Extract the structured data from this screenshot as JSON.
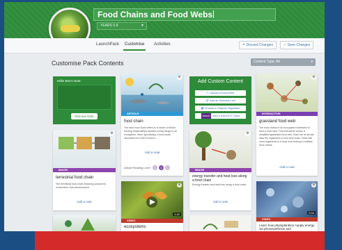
{
  "pack": {
    "title": "Food Chains and Food Webs",
    "level_select": "YEARS 5-8"
  },
  "tabs": [
    {
      "label": "LaunchPack"
    },
    {
      "label": "Customise"
    },
    {
      "label": "Activities"
    }
  ],
  "header_buttons": {
    "discard": "Discard Changes",
    "save": "Save Changes"
  },
  "content": {
    "section_title": "Customise Pack Contents",
    "filter": "Content Type: All"
  },
  "note_card": {
    "label": "Millie Ben's Note:",
    "remove": "Remove Note"
  },
  "custom_card": {
    "title": "Add Custom Content",
    "upload": "Upload a Document",
    "link": "Add an External Link",
    "organiser": "Choose a Graphic Organiser",
    "kahoot_tag": "kahoot",
    "kahoot": "Add a KAHOOT! Quiz"
  },
  "cards": {
    "food_chain": {
      "tag": "ARTICLE",
      "title": "food chain",
      "desc": "The term food chain refers to a series of linked feeding relationships between living things in an ecosystem. More specifically, a food chain describes the order in which...",
      "add_note": "Add a note",
      "reading_label": "Article Reading Level",
      "levels": [
        "1",
        "2",
        "3"
      ]
    },
    "grassland": {
      "tag": "INTERACTIVE",
      "title": "grassland food web",
      "desc": "The food chains in an ecosystem intertwine to form a food web. This interactive shows a simplified grassland food web. Each set of arrows links the organisms in one food chain. Note that most organisms in a food web belong to multiple food chains.",
      "add_note": "Add a note"
    },
    "terrestrial": {
      "tag": "IMAGE",
      "title": "terrestrial food chain",
      "desc": "The terrestrial food chain featuring producers, consumers, and decomposers.",
      "add_note": "Add a note"
    },
    "energy": {
      "tag": "IMAGE",
      "title": "energy transfer and heat loss along a food chain",
      "desc": "Energy transfer and heat loss along a food chain.",
      "add_note": "Add a note"
    },
    "ecosystems": {
      "tag": "VIDEO",
      "title": "ecosystems",
      "duration": "1:42"
    },
    "video3": {
      "tag": "VIDEO",
      "duration": "0:34",
      "title": "Learn how phytoplankton supply energy via photosynthesis and"
    }
  }
}
